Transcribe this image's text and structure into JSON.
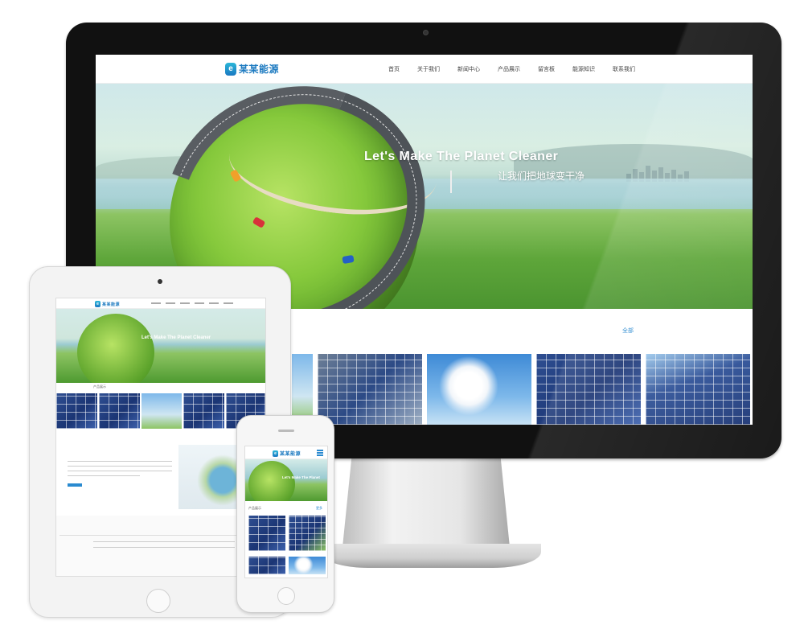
{
  "site": {
    "logo_glyph": "e",
    "logo_text": "某某能源",
    "nav": [
      "首页",
      "关于我们",
      "新闻中心",
      "产品展示",
      "留言板",
      "能源知识",
      "联系我们"
    ],
    "brand_color": "#1c7ac0",
    "accent_color": "#2a8ad0"
  },
  "banner": {
    "title": "Let's Make The Planet Cleaner",
    "subtitle": "让我们把地球变干净",
    "tablet_title": "Let's Make The Planet Cleaner",
    "phone_title": "Let's Make The Planet"
  },
  "products": {
    "all_link": "全部",
    "thumbnails": [
      "solar-panel-grass",
      "solar-panel-sky",
      "wind-turbine-clouds",
      "solar-panel-blue",
      "solar-panel-sun"
    ]
  },
  "tablet": {
    "section_title": "产品展示",
    "news_title": "新闻中心"
  },
  "phone": {
    "section_title": "产品展示",
    "more_link": "更多"
  },
  "icons": [
    "logo-icon",
    "menu-icon",
    "camera-icon",
    "home-button-icon"
  ]
}
